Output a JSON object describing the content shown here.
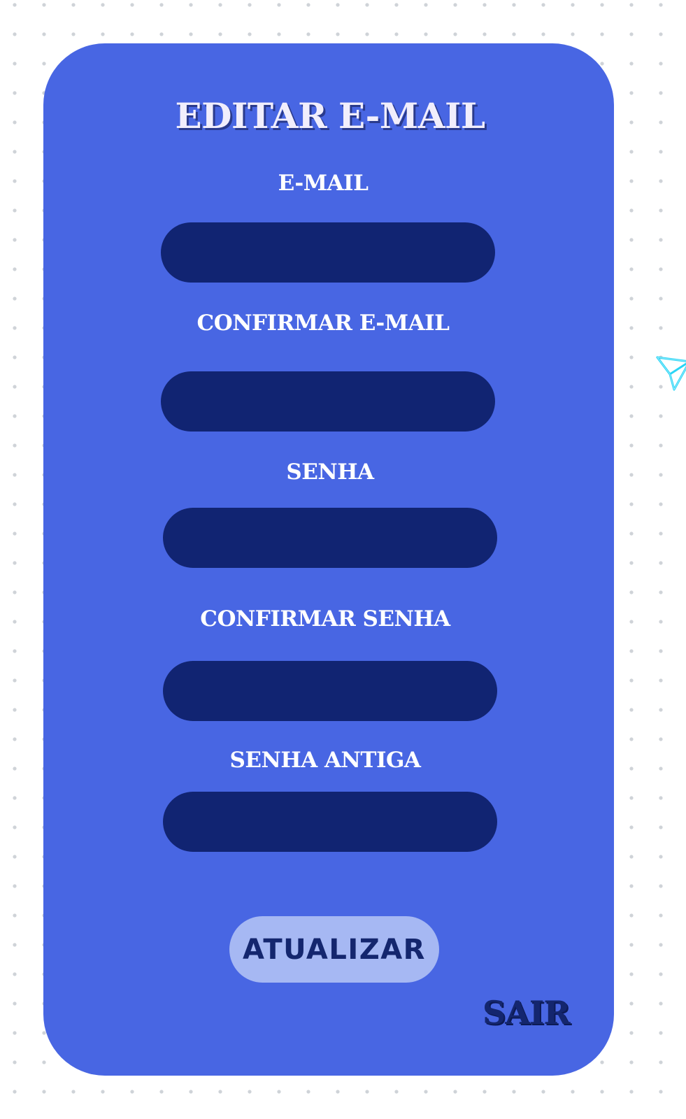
{
  "form": {
    "title": "EDITAR E-MAIL",
    "fields": [
      {
        "label": "E-MAIL",
        "value": "",
        "placeholder": ""
      },
      {
        "label": "CONFIRMAR E-MAIL",
        "value": "",
        "placeholder": ""
      },
      {
        "label": "SENHA",
        "value": "",
        "placeholder": ""
      },
      {
        "label": "CONFIRMAR SENHA",
        "value": "",
        "placeholder": ""
      },
      {
        "label": "SENHA ANTIGA",
        "value": "",
        "placeholder": ""
      }
    ],
    "submit_label": "ATUALIZAR",
    "exit_label": "SAIR"
  },
  "decorations": {
    "side_icon": "paper-plane-icon"
  },
  "colors": {
    "card_background": "#4866e3",
    "input_background": "#112472",
    "button_background": "#a6b8f3",
    "button_text": "#14266e",
    "exit_text": "#14266e",
    "icon_glow": "#1fd3f5"
  }
}
